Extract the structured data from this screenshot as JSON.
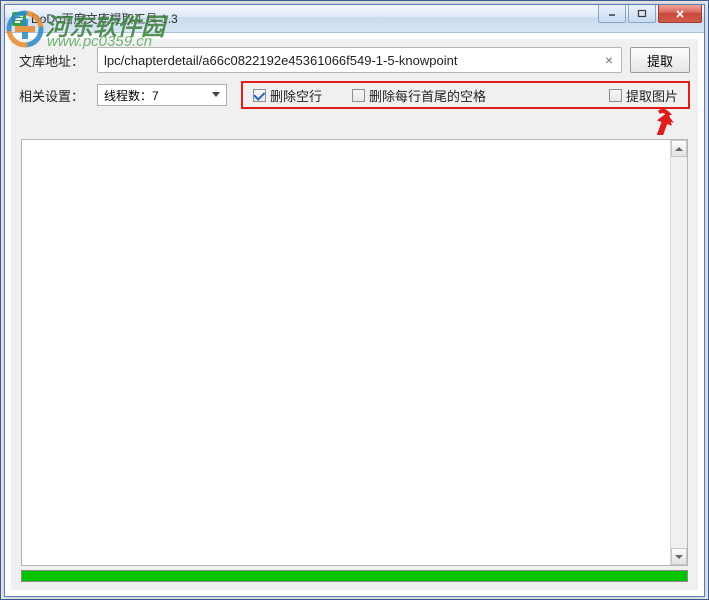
{
  "window": {
    "title": "DoDo百度文库提取工具  1.3"
  },
  "watermark": {
    "text": "河东软件园",
    "url": "www.pc0359.cn"
  },
  "form": {
    "url_label": "文库地址：",
    "url_value": "lpc/chapterdetail/a66c0822192e45361066f549-1-5-knowpoint",
    "extract_btn": "提取",
    "settings_label": "相关设置：",
    "thread_combo": "线程数：7",
    "chk_remove_blank": "删除空行",
    "chk_trim_spaces": "删除每行首尾的空格",
    "chk_extract_images": "提取图片",
    "chk_remove_blank_checked": true,
    "chk_trim_spaces_checked": false,
    "chk_extract_images_checked": false
  },
  "colors": {
    "highlight_box": "#e01b1b",
    "progress": "#00c400"
  }
}
